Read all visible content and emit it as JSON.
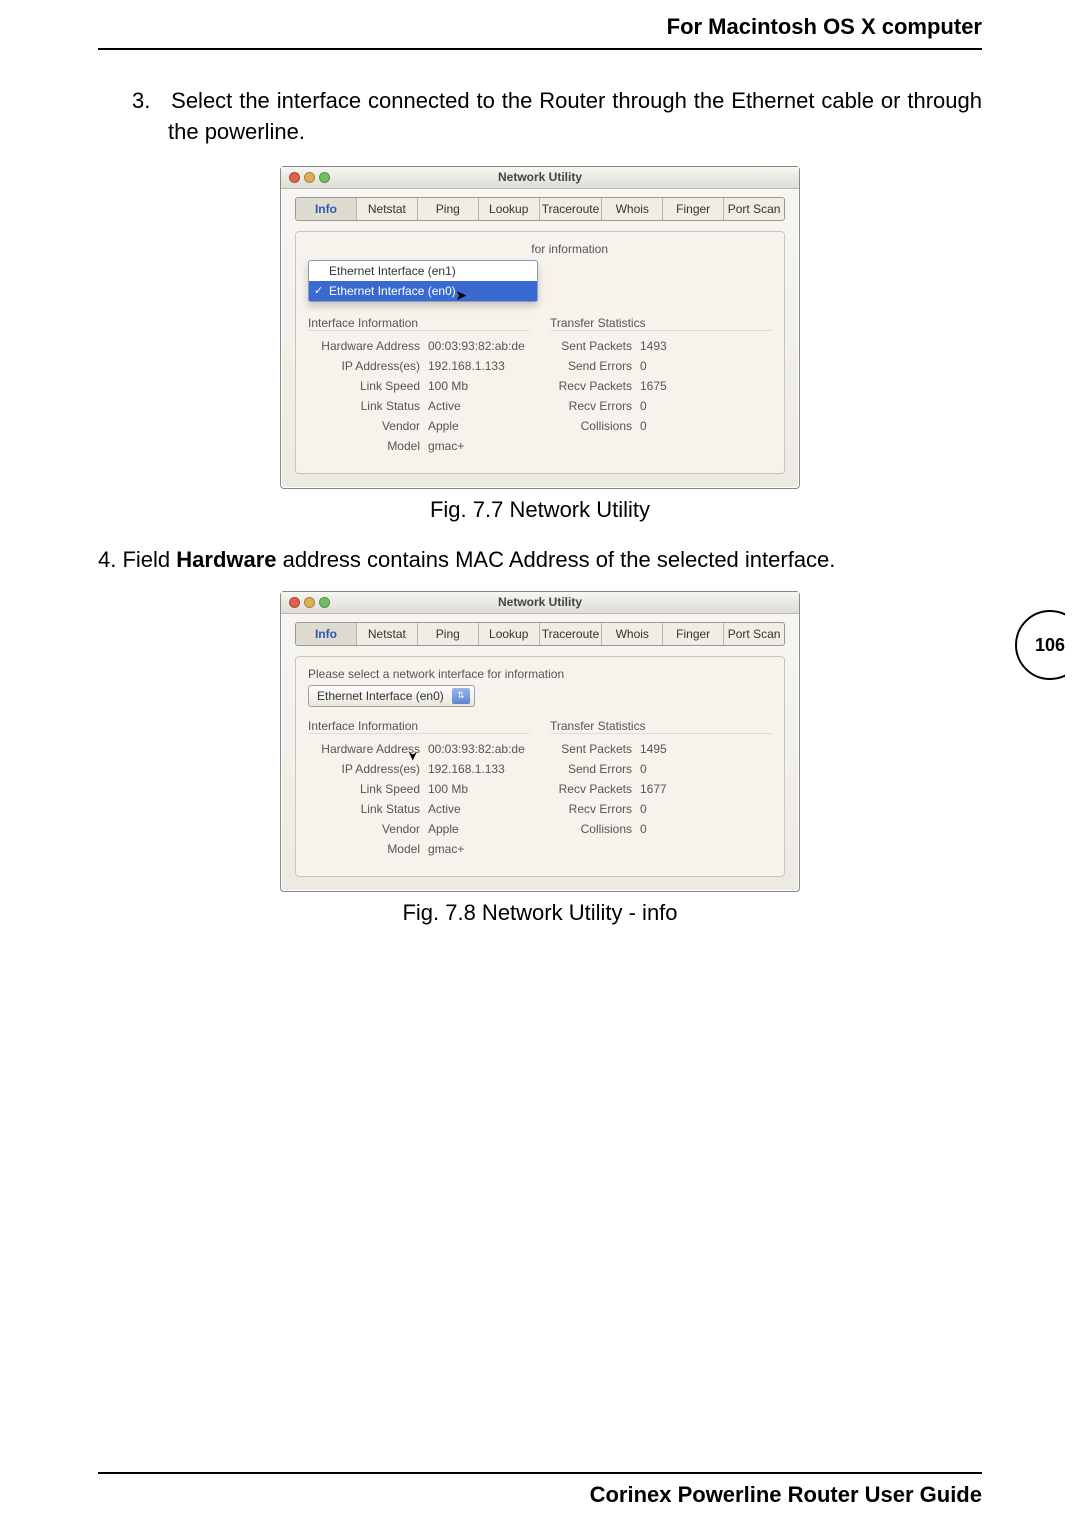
{
  "header": "For Macintosh OS X computer",
  "step3_num": "3.",
  "step3_text": "Select the interface connected to the Router through the Ethernet cable or through the powerline.",
  "window": {
    "title": "Network Utility",
    "tabs": [
      "Info",
      "Netstat",
      "Ping",
      "Lookup",
      "Traceroute",
      "Whois",
      "Finger",
      "Port Scan"
    ],
    "prompt_partial": "for information",
    "prompt_full": "Please select a network interface for information",
    "dropdown": {
      "option1": "Ethernet Interface (en1)",
      "option0": "Ethernet Interface (en0)"
    },
    "interface_info_title": "Interface Information",
    "transfer_stats_title": "Transfer Statistics",
    "fields": {
      "hw_addr_lbl": "Hardware Address",
      "hw_addr_val": "00:03:93:82:ab:de",
      "ip_lbl": "IP Address(es)",
      "ip_val": "192.168.1.133",
      "link_speed_lbl": "Link Speed",
      "link_speed_val": "100 Mb",
      "link_status_lbl": "Link Status",
      "link_status_val": "Active",
      "vendor_lbl": "Vendor",
      "vendor_val": "Apple",
      "model_lbl": "Model",
      "model_val": "gmac+"
    },
    "stats_a": {
      "sent_pkt_lbl": "Sent Packets",
      "sent_pkt_val": "1493",
      "send_err_lbl": "Send Errors",
      "send_err_val": "0",
      "recv_pkt_lbl": "Recv Packets",
      "recv_pkt_val": "1675",
      "recv_err_lbl": "Recv Errors",
      "recv_err_val": "0",
      "coll_lbl": "Collisions",
      "coll_val": "0"
    },
    "stats_b": {
      "sent_pkt_lbl": "Sent Packets",
      "sent_pkt_val": "1495",
      "send_err_lbl": "Send Errors",
      "send_err_val": "0",
      "recv_pkt_lbl": "Recv Packets",
      "recv_pkt_val": "1677",
      "recv_err_lbl": "Recv Errors",
      "recv_err_val": "0",
      "coll_lbl": "Collisions",
      "coll_val": "0"
    }
  },
  "fig77": "Fig. 7.7 Network Utility",
  "step4_a": "4. Field ",
  "step4_b": "Hardware",
  "step4_c": " address contains MAC Address of the selected interface.",
  "fig78": "Fig. 7.8 Network Utility - info",
  "page_num": "106",
  "footer": "Corinex Powerline Router User Guide"
}
